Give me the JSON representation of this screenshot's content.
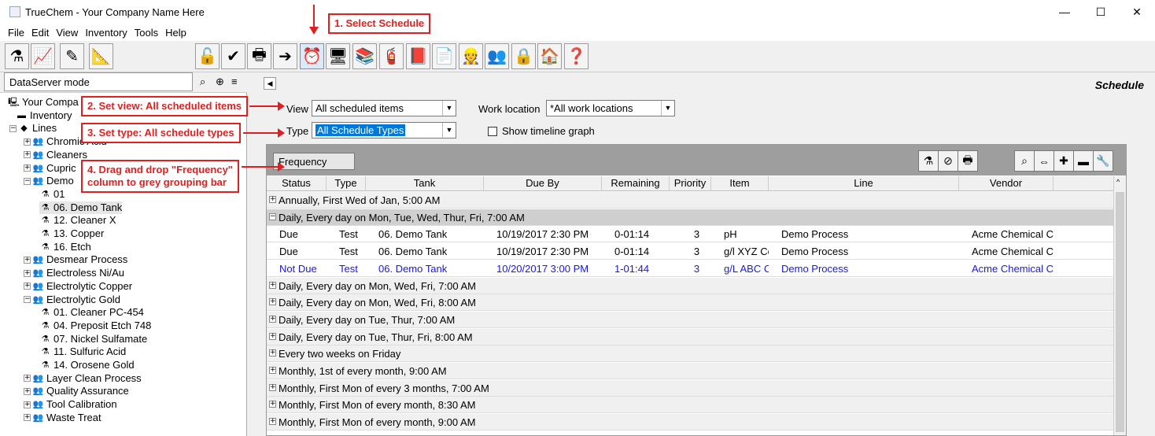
{
  "window": {
    "title": "TrueChem - Your Company Name Here",
    "minimize": "—",
    "maximize": "☐",
    "close": "✕"
  },
  "menu": [
    "File",
    "Edit",
    "View",
    "Inventory",
    "Tools",
    "Help"
  ],
  "left_panel": {
    "mode": "DataServer mode",
    "tree": [
      {
        "label": "Your Compa",
        "icon": "computer-icon",
        "expander": ""
      },
      {
        "label": "Inventory",
        "icon": "inventory-icon",
        "expander": ""
      },
      {
        "label": "Lines",
        "icon": "lines-icon",
        "expander": "−"
      },
      {
        "label": "Chromic Acid",
        "icon": "line-group-icon",
        "expander": "+"
      },
      {
        "label": "Cleaners",
        "icon": "line-group-icon",
        "expander": "+"
      },
      {
        "label": "Cupric",
        "icon": "line-group-icon",
        "expander": "+"
      },
      {
        "label": "Demo",
        "icon": "line-group-icon",
        "expander": "−"
      },
      {
        "label": "01",
        "icon": "tank-icon",
        "expander": ""
      },
      {
        "label": "06. Demo Tank",
        "icon": "tank-icon",
        "expander": ""
      },
      {
        "label": "12. Cleaner X",
        "icon": "tank-icon",
        "expander": ""
      },
      {
        "label": "13. Copper",
        "icon": "tank-icon",
        "expander": ""
      },
      {
        "label": "16. Etch",
        "icon": "tank-icon",
        "expander": ""
      },
      {
        "label": "Desmear Process",
        "icon": "line-group-icon",
        "expander": "+"
      },
      {
        "label": "Electroless Ni/Au",
        "icon": "line-group-icon",
        "expander": "+"
      },
      {
        "label": "Electrolytic Copper",
        "icon": "line-group-icon",
        "expander": "+"
      },
      {
        "label": "Electrolytic Gold",
        "icon": "line-group-icon",
        "expander": "−"
      },
      {
        "label": "01. Cleaner PC-454",
        "icon": "tank-icon",
        "expander": ""
      },
      {
        "label": "04. Preposit Etch 748",
        "icon": "tank-icon",
        "expander": ""
      },
      {
        "label": "07. Nickel Sulfamate",
        "icon": "tank-icon",
        "expander": ""
      },
      {
        "label": "11. Sulfuric Acid",
        "icon": "tank-icon",
        "expander": ""
      },
      {
        "label": "14. Orosene Gold",
        "icon": "tank-icon",
        "expander": ""
      },
      {
        "label": "Layer Clean Process",
        "icon": "line-group-icon",
        "expander": "+"
      },
      {
        "label": "Quality Assurance",
        "icon": "line-group-icon",
        "expander": "+"
      },
      {
        "label": "Tool Calibration",
        "icon": "line-group-icon",
        "expander": "+"
      },
      {
        "label": "Waste Treat",
        "icon": "line-group-icon",
        "expander": "+"
      }
    ]
  },
  "schedule": {
    "heading": "Schedule",
    "view_label": "View",
    "view_value": "All scheduled items",
    "work_location_label": "Work location",
    "work_location_value": "*All work locations",
    "type_label": "Type",
    "type_value": "All Schedule Types",
    "timeline_label": "Show timeline graph",
    "group_chip": "Frequency",
    "columns": [
      "Status",
      "Type",
      "Tank",
      "Due By",
      "Remaining",
      "Priority",
      "Item Description",
      "Line",
      "Vendor"
    ],
    "group_rows": [
      {
        "label": "Annually, First Wed of Jan, 5:00 AM",
        "pm": "+"
      },
      {
        "label": "Daily, Every day on Mon, Tue, Wed, Thur, Fri, 7:00 AM",
        "pm": "−"
      },
      {
        "label": "Daily, Every day on Mon, Wed, Fri, 7:00 AM",
        "pm": "+"
      },
      {
        "label": "Daily, Every day on Mon, Wed, Fri, 8:00 AM",
        "pm": "+"
      },
      {
        "label": "Daily, Every day on Tue, Thur, 7:00 AM",
        "pm": "+"
      },
      {
        "label": "Daily, Every day on Tue, Thur, Fri, 8:00 AM",
        "pm": "+"
      },
      {
        "label": "Every two weeks on Friday",
        "pm": "+"
      },
      {
        "label": "Monthly, 1st of every month, 9:00 AM",
        "pm": "+"
      },
      {
        "label": "Monthly, First Mon of every 3 months, 7:00 AM",
        "pm": "+"
      },
      {
        "label": "Monthly, First Mon of every month, 8:30 AM",
        "pm": "+"
      },
      {
        "label": "Monthly, First Mon of every month, 9:00 AM",
        "pm": "+"
      }
    ],
    "data_rows": [
      {
        "status": "Due",
        "type": "Test",
        "tank": "06. Demo Tank",
        "due_by": "10/19/2017 2:30 PM",
        "remaining": "0-01:14",
        "priority": "3",
        "item": "pH",
        "line": "Demo Process",
        "vendor": "Acme Chemical Company"
      },
      {
        "status": "Due",
        "type": "Test",
        "tank": "06. Demo Tank",
        "due_by": "10/19/2017 2:30 PM",
        "remaining": "0-01:14",
        "priority": "3",
        "item": "g/l XYZ Concentration",
        "line": "Demo Process",
        "vendor": "Acme Chemical Company"
      },
      {
        "status": "Not Due",
        "type": "Test",
        "tank": "06. Demo Tank",
        "due_by": "10/20/2017 3:00 PM",
        "remaining": "1-01:44",
        "priority": "3",
        "item": "g/L ABC Concentration",
        "line": "Demo Process",
        "vendor": "Acme Chemical Company"
      }
    ]
  },
  "callouts": {
    "step1": "1. Select Schedule",
    "step2": "2. Set view: All scheduled items",
    "step3": "3. Set type: All schedule types",
    "step4a": "4. Drag and drop \"Frequency\"",
    "step4b": "column to grey grouping bar"
  },
  "colors": {
    "callout_red": "#e02020",
    "selected_blue": "#0078d7",
    "not_due_text": "#1818e0"
  }
}
